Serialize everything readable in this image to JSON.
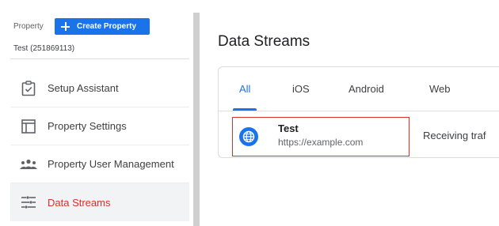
{
  "property": {
    "label": "Property",
    "create_button_label": "Create Property",
    "name": "Test (251869113)"
  },
  "sidebar": {
    "items": [
      {
        "label": "Setup Assistant",
        "icon": "clipboard-check-icon",
        "active": false
      },
      {
        "label": "Property Settings",
        "icon": "layout-icon",
        "active": false
      },
      {
        "label": "Property User Management",
        "icon": "people-icon",
        "active": false
      },
      {
        "label": "Data Streams",
        "icon": "data-streams-icon",
        "active": true
      }
    ]
  },
  "main": {
    "title": "Data Streams",
    "tabs": [
      {
        "label": "All",
        "active": true
      },
      {
        "label": "iOS",
        "active": false
      },
      {
        "label": "Android",
        "active": false
      },
      {
        "label": "Web",
        "active": false
      }
    ],
    "stream": {
      "name": "Test",
      "url": "https://example.com",
      "icon": "globe-icon",
      "status": "Receiving traf"
    }
  },
  "colors": {
    "accent": "#1a73e8",
    "active_nav_text": "#d93025",
    "highlight_border": "#d0342c"
  }
}
